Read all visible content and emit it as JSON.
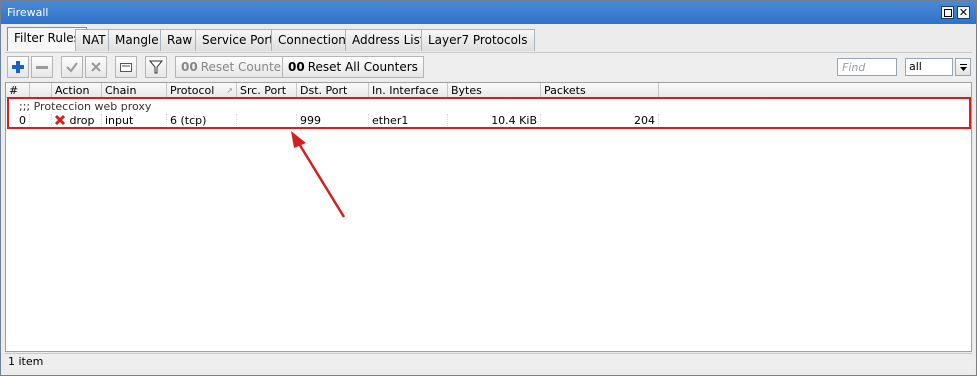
{
  "window": {
    "title": "Firewall"
  },
  "tabs": [
    "Filter Rules",
    "NAT",
    "Mangle",
    "Raw",
    "Service Ports",
    "Connections",
    "Address Lists",
    "Layer7 Protocols"
  ],
  "toolbar": {
    "reset_counters_label": "Reset Counters",
    "reset_all_counters_label": "Reset All Counters",
    "counter_prefix": "00",
    "find_placeholder": "Find",
    "filter_select_value": "all"
  },
  "table": {
    "columns": [
      "#",
      "",
      "Action",
      "Chain",
      "Protocol",
      "Src. Port",
      "Dst. Port",
      "In. Interface",
      "Bytes",
      "Packets"
    ],
    "comment": ";;; Proteccion web proxy",
    "rows": [
      {
        "num": "0",
        "action": "drop",
        "chain": "input",
        "protocol": "6 (tcp)",
        "src_port": "",
        "dst_port": "999",
        "in_interface": "ether1",
        "bytes": "10.4 KiB",
        "packets": "204"
      }
    ]
  },
  "status": {
    "item_count": "1 item"
  },
  "colors": {
    "highlight": "#d21f1f",
    "titlebar": "#2f73c8",
    "add_button": "#1c5fc4"
  }
}
